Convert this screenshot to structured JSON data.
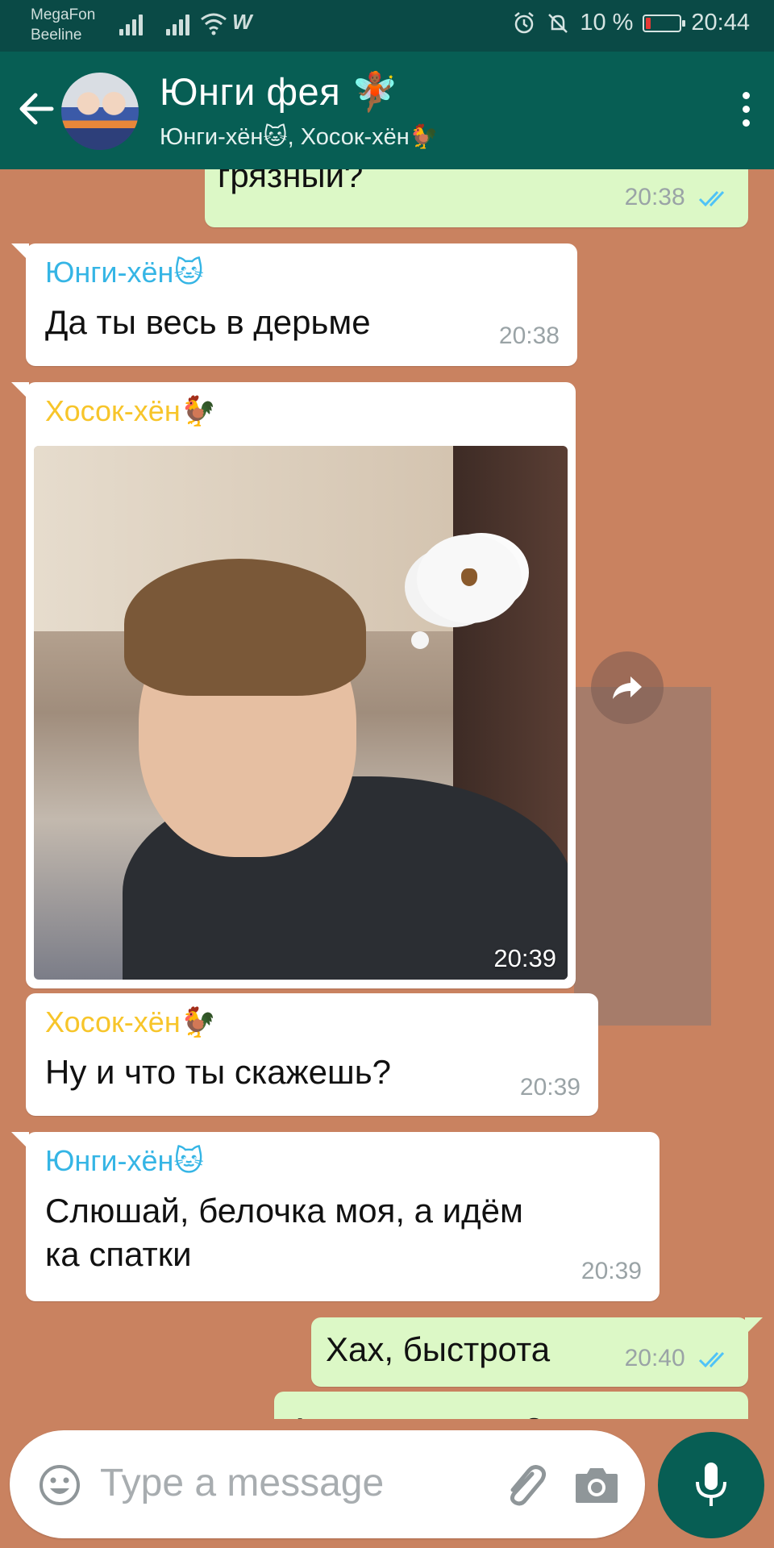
{
  "status_bar": {
    "carrier_1": "MegaFon",
    "carrier_2": "Beeline",
    "battery": "10 %",
    "time": "20:44"
  },
  "header": {
    "title": "Юнги фея 🧚🏾",
    "subtitle": "Юнги-хён🐱, Хосок-хён🐓"
  },
  "messages": [
    {
      "direction": "out",
      "text": "грязный?",
      "time": "20:38"
    },
    {
      "direction": "in",
      "sender": "Юнги-хён🐱",
      "text": "Да ты весь в дерьме",
      "time": "20:38"
    },
    {
      "direction": "in",
      "sender": "Хосок-хён🐓",
      "type": "image",
      "time": "20:39"
    },
    {
      "direction": "in",
      "sender": "Хосок-хён🐓",
      "text": "Ну и что ты скажешь?",
      "time": "20:39"
    },
    {
      "direction": "in",
      "sender": "Юнги-хён🐱",
      "text_line_1": "Слюшай, белочка моя, а идём",
      "text_line_2": "ка спатки",
      "time": "20:39"
    },
    {
      "direction": "out",
      "text": "Хах, быстрота",
      "time": "20:40"
    },
    {
      "direction": "out",
      "text": "А как же давно?"
    }
  ],
  "input": {
    "placeholder": "Type a message"
  },
  "colors": {
    "header": "#075e54",
    "status_bar": "#0a4a46",
    "chat_background": "#c98260",
    "outgoing_bubble": "#dcf8c6",
    "incoming_bubble": "#ffffff",
    "sender_yunggi": "#35b5e5",
    "sender_hosok": "#f7c52a",
    "read_ticks": "#4fc3f7"
  },
  "icons": [
    "back-arrow-icon",
    "more-vert-icon",
    "forward-icon",
    "emoji-icon",
    "attach-icon",
    "camera-icon",
    "mic-icon",
    "double-check-icon"
  ]
}
